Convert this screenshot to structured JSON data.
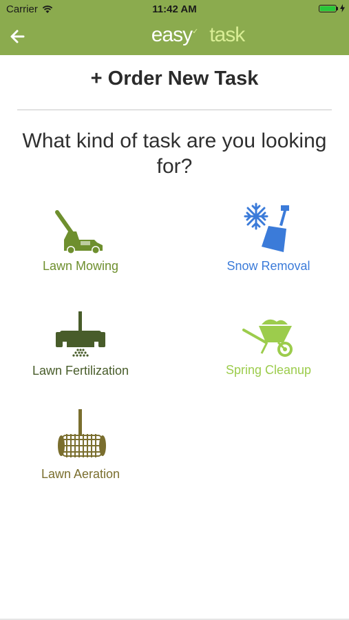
{
  "status_bar": {
    "carrier": "Carrier",
    "time": "11:42 AM"
  },
  "header": {
    "logo_task": "task",
    "logo_easy": "easy"
  },
  "page": {
    "title": "+ Order New Task",
    "prompt": "What kind of task are you looking for?"
  },
  "tasks": [
    {
      "label": "Lawn Mowing",
      "icon": "lawn-mower-icon",
      "color": "#6e8f2e"
    },
    {
      "label": "Snow Removal",
      "icon": "snow-shovel-icon",
      "color": "#3b7bd9"
    },
    {
      "label": "Lawn Fertilization",
      "icon": "fertilizer-spreader-icon",
      "color": "#485c2a"
    },
    {
      "label": "Spring Cleanup",
      "icon": "wheelbarrow-icon",
      "color": "#9ccc4c"
    },
    {
      "label": "Lawn Aeration",
      "icon": "aerator-icon",
      "color": "#7a6e2e"
    }
  ],
  "colors": {
    "brand_green": "#8bab4e",
    "title_text": "#2b2b2b"
  }
}
